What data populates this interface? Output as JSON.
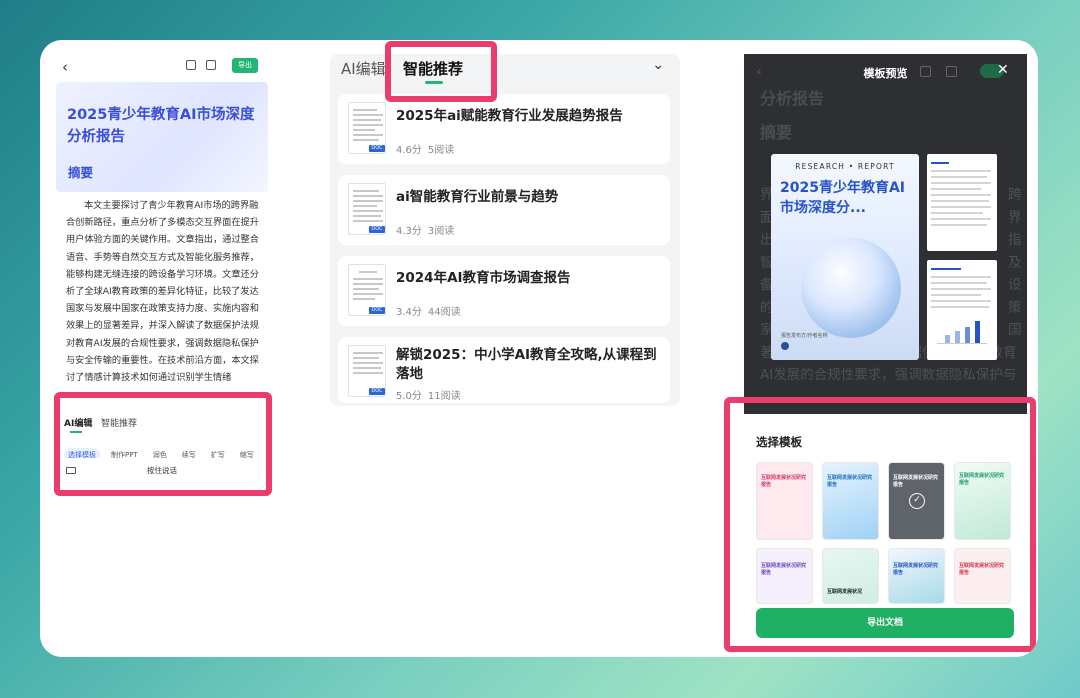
{
  "left_phone": {
    "back_icon": "chevron-left-icon",
    "export_label": "导出",
    "doc_title": "2025青少年教育AI市场深度分析报告",
    "abstract_heading": "摘要",
    "abstract_text": "本文主要探讨了青少年教育AI市场的跨界融合创新路径，重点分析了多模态交互界面在提升用户体验方面的关键作用。文章指出，通过整合语音、手势等自然交互方式及智能化服务推荐，能够构建无缝连接的跨设备学习环境。文章还分析了全球AI教育政策的差异化特征，比较了发达国家与发展中国家在政策支持力度、实施内容和效果上的显著差异，并深入解读了数据保护法规对教育AI发展的合规性要求，强调数据隐私保护与安全传输的重要性。在技术前沿方面，本文探讨了情感计算技术如何通过识别学生情绪",
    "panel": {
      "tab_ai_edit": "AI编辑",
      "tab_recommend": "智能推荐",
      "chips": [
        "选择模板",
        "制作PPT",
        "润色",
        "续写",
        "扩写",
        "缩写"
      ],
      "voice_label": "按住说话"
    }
  },
  "middle": {
    "tab_ai_edit": "AI编辑",
    "tab_recommend": "智能推荐",
    "docs": [
      {
        "title": "2025年ai赋能教育行业发展趋势报告",
        "score": "4.6分",
        "reads": "5阅读"
      },
      {
        "title": "ai智能教育行业前景与趋势",
        "score": "4.3分",
        "reads": "3阅读"
      },
      {
        "title": "2024年AI教育市场调查报告",
        "score": "3.4分",
        "reads": "44阅读"
      },
      {
        "title": "解锁2025：中小学AI教育全攻略,从课程到落地",
        "score": "5.0分",
        "reads": "11阅读"
      }
    ],
    "badge": "DOC"
  },
  "right_phone": {
    "title": "模板预览",
    "bg_title": "分析报告",
    "bg_abstract": "摘要",
    "bg_lines": [
      "界",
      "面",
      "出",
      "智",
      "备",
      "的",
      "家",
      "著差异，并深入解读了数据保护法规对教育",
      "AI发展的合规性要求，强调数据隐私保护与"
    ],
    "bg_right_chars": [
      "跨",
      "界",
      "指",
      "及",
      "设",
      "策",
      "国",
      "显",
      "育"
    ],
    "cover": {
      "kicker": "RESEARCH • REPORT",
      "title": "2025青少年教育AI市场深度分...",
      "footer": "报告发布方/作者名称"
    },
    "chooser": {
      "title": "选择模板",
      "templates": [
        {
          "title": "互联网发展状况研究报告",
          "bg": "#fde9ee",
          "fg": "#d83a6a"
        },
        {
          "title": "互联网发展状况研究报告",
          "bg": "#cfe9fb",
          "fg": "#1f6fc2"
        },
        {
          "title": "互联网发展状况研究报告",
          "bg": "#5f646b",
          "fg": "#ffffff"
        },
        {
          "title": "互联网发展状况研究报告",
          "bg": "#e3f6ee",
          "fg": "#1e9f6a"
        },
        {
          "title": "互联网发展状况研究报告",
          "bg": "#f5f0fb",
          "fg": "#6a48c8"
        },
        {
          "title": "互联网发展状况",
          "bg": "#e8f6f2",
          "fg": "#20262e"
        },
        {
          "title": "互联网发展状况研究报告",
          "bg": "#f2f6ff",
          "fg": "#2653c8"
        },
        {
          "title": "互联网发展状况研究报告",
          "bg": "#fdeef0",
          "fg": "#d8364a"
        }
      ],
      "export_label": "导出文档"
    }
  }
}
